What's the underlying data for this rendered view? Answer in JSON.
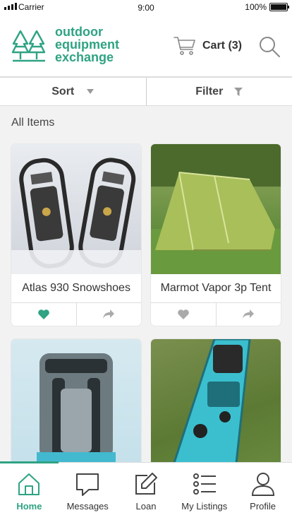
{
  "status_bar": {
    "carrier": "Carrier",
    "time": "9:00",
    "battery": "100%"
  },
  "header": {
    "brand_line1": "outdoor",
    "brand_line2": "equipment",
    "brand_line3": "exchange",
    "cart_label": "Cart (3)",
    "logo_icon": "pine-trees-icon",
    "cart_icon": "shopping-cart-icon",
    "search_icon": "search-icon"
  },
  "toolbar": {
    "sort_label": "Sort",
    "filter_label": "Filter"
  },
  "section_title": "All Items",
  "items": [
    {
      "title": "Atlas 930 Snowshoes",
      "liked": true
    },
    {
      "title": "Marmot Vapor 3p Tent",
      "liked": false
    },
    {
      "title": "",
      "liked": false
    },
    {
      "title": "",
      "liked": false
    }
  ],
  "nav": {
    "tabs": [
      {
        "label": "Home",
        "icon": "home-icon",
        "active": true
      },
      {
        "label": "Messages",
        "icon": "chat-bubble-icon",
        "active": false
      },
      {
        "label": "Loan",
        "icon": "edit-icon",
        "active": false
      },
      {
        "label": "My Listings",
        "icon": "list-icon",
        "active": false
      },
      {
        "label": "Profile",
        "icon": "user-icon",
        "active": false
      }
    ]
  },
  "colors": {
    "accent": "#2fa383",
    "text": "#333333",
    "background": "#f2f2f2"
  }
}
